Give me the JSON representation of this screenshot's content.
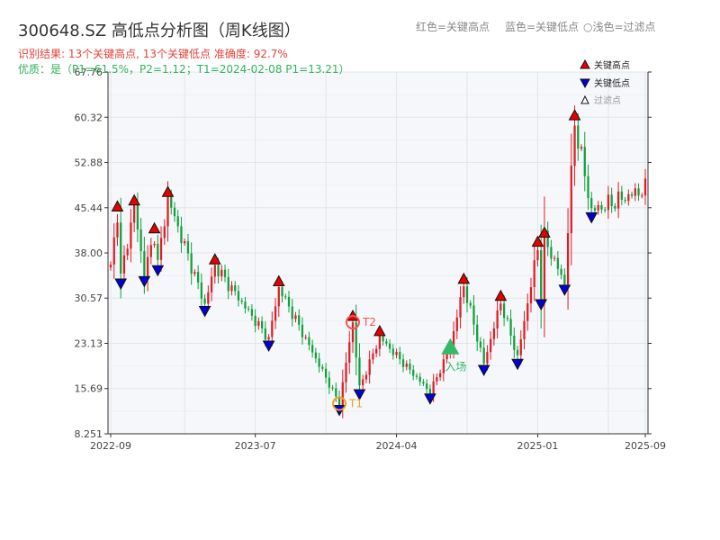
{
  "header": {
    "title": "300648.SZ 高低点分析图（周K线图）",
    "result_line": "识别结果: 13个关键高点, 13个关键低点  准确度: 92.7%",
    "quality_line": "优质：是（P1=61.5%，P2=1.12；T1=2024-02-08 P1=13.21）"
  },
  "top_legend": {
    "red": "红色=关键高点",
    "blue": "蓝色=关键低点",
    "light": "浅色=过滤点"
  },
  "colors": {
    "up": "#e01b24",
    "down": "#10a03c",
    "high_marker": "#e60000",
    "low_marker": "#0000d6",
    "t1": "#f0a020",
    "t2": "#ff5050",
    "entry": "#36b86a",
    "plot_bg": "#f5f7fa",
    "grid": "#e2e6ea"
  },
  "chart_data": {
    "type": "candlestick",
    "title": "300648.SZ 高低点分析图（周K线图）",
    "y_ticks": [
      8.251,
      15.69,
      23.13,
      30.57,
      38.0,
      45.44,
      52.88,
      60.32,
      67.76
    ],
    "y_tick_labels": [
      "8.251",
      "15.69",
      "23.13",
      "30.57",
      "38.00",
      "45.44",
      "52.88",
      "60.32",
      "67.76"
    ],
    "ylim": [
      8.251,
      67.76
    ],
    "x_ticks": [
      "2022-09",
      "2023-07",
      "2024-04",
      "2025-01",
      "2025-09"
    ],
    "weeks": 160,
    "grid": true,
    "legend": {
      "position": "top-right",
      "entries": [
        "关键高点",
        "关键低点",
        "过滤点"
      ]
    },
    "key_highs": [
      {
        "week": 2,
        "price": 44.6
      },
      {
        "week": 7,
        "price": 45.6
      },
      {
        "week": 13,
        "price": 41.0
      },
      {
        "week": 17,
        "price": 47.0
      },
      {
        "week": 31,
        "price": 35.9
      },
      {
        "week": 50,
        "price": 32.3
      },
      {
        "week": 72,
        "price": 26.6
      },
      {
        "week": 80,
        "price": 24.1
      },
      {
        "week": 105,
        "price": 32.7
      },
      {
        "week": 116,
        "price": 29.9
      },
      {
        "week": 127,
        "price": 38.8
      },
      {
        "week": 129,
        "price": 40.3
      },
      {
        "week": 138,
        "price": 59.6
      }
    ],
    "key_lows": [
      {
        "week": 3,
        "price": 34.0
      },
      {
        "week": 10,
        "price": 34.4
      },
      {
        "week": 14,
        "price": 36.2
      },
      {
        "week": 28,
        "price": 29.5
      },
      {
        "week": 47,
        "price": 23.8
      },
      {
        "week": 68,
        "price": 13.21
      },
      {
        "week": 74,
        "price": 15.8
      },
      {
        "week": 95,
        "price": 15.1
      },
      {
        "week": 111,
        "price": 19.8
      },
      {
        "week": 121,
        "price": 20.8
      },
      {
        "week": 128,
        "price": 30.6
      },
      {
        "week": 135,
        "price": 33.0
      },
      {
        "week": 143,
        "price": 44.9
      }
    ],
    "annotations": {
      "t1": {
        "label": "T1",
        "week": 68,
        "price": 13.21
      },
      "t2": {
        "label": "T2",
        "week": 72,
        "price": 26.6
      },
      "entry": {
        "label": "入场",
        "week": 101,
        "price": 22.5
      }
    }
  }
}
